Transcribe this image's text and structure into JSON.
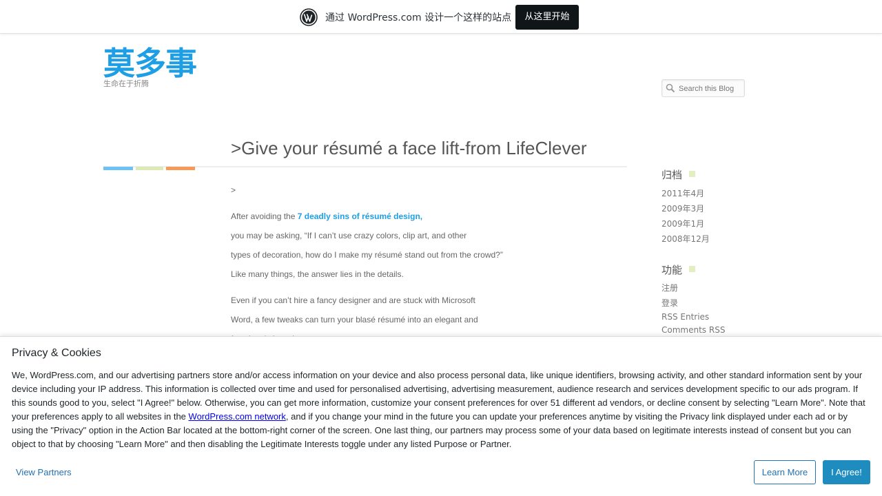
{
  "wpbar": {
    "logo_icon": "wordpress-logo-icon",
    "promo_text": "通过 WordPress.com 设计一个这样的站点",
    "start_button": "从这里开始"
  },
  "site": {
    "title": "莫多事",
    "description": "生命在于折腾"
  },
  "search": {
    "icon": "search-icon",
    "placeholder": "Search this Blog"
  },
  "post": {
    "title": ">Give your résumé a face lift-from LifeClever",
    "lines": [
      ">",
      "After avoiding the ",
      "7 deadly sins of résumé design,",
      "you may be asking, “If I can’t use crazy colors, clip art, and other",
      "types of decoration, how do I make my résumé stand out from the crowd?”",
      "Like many things, the answer lies in the details.",
      "Even if you can’t hire a fancy designer and are stuck with Microsoft",
      "Word, a few tweaks can turn your blasé résumé into an elegant and",
      "functional showpiece."
    ]
  },
  "sidebar": {
    "archives_title": "归档",
    "archives": [
      "2011年4月",
      "2009年3月",
      "2009年1月",
      "2008年12月"
    ],
    "functions_title": "功能",
    "functions": [
      "注册",
      "登录",
      "RSS Entries",
      "Comments RSS"
    ]
  },
  "privacy": {
    "title": "Privacy & Cookies",
    "text_before_link": "We, WordPress.com, and our advertising partners store and/or access information on your device and also process personal data, like unique identifiers, browsing activity, and other standard information sent by your device including your IP address. This information is collected over time and used for personalised advertising, advertising measurement, audience research and services development specific to our ads program. If this sounds good to you, select \"I Agree!\" below. Otherwise, you can get more information, customize your consent preferences for over 51 different ad vendors, or decline consent by selecting \"Learn More\". Note that your preferences apply to all websites in the ",
    "link_text": "WordPress.com network",
    "text_after_link": ", and if you change your mind in the future you can update your preferences anytime by visiting the Privacy link displayed under each ad or by using the \"Privacy\" option in the Action Bar located at the bottom-right corner of the screen. One last thing, our partners may process some of your data based on legitimate interests instead of consent but you can object to that by choosing \"Learn More\" and then disabling the Legitimate Interests toggle under any listed Purpose or Partner.",
    "view_partners": "View Partners",
    "learn_more": "Learn More",
    "agree": "I Agree!"
  }
}
